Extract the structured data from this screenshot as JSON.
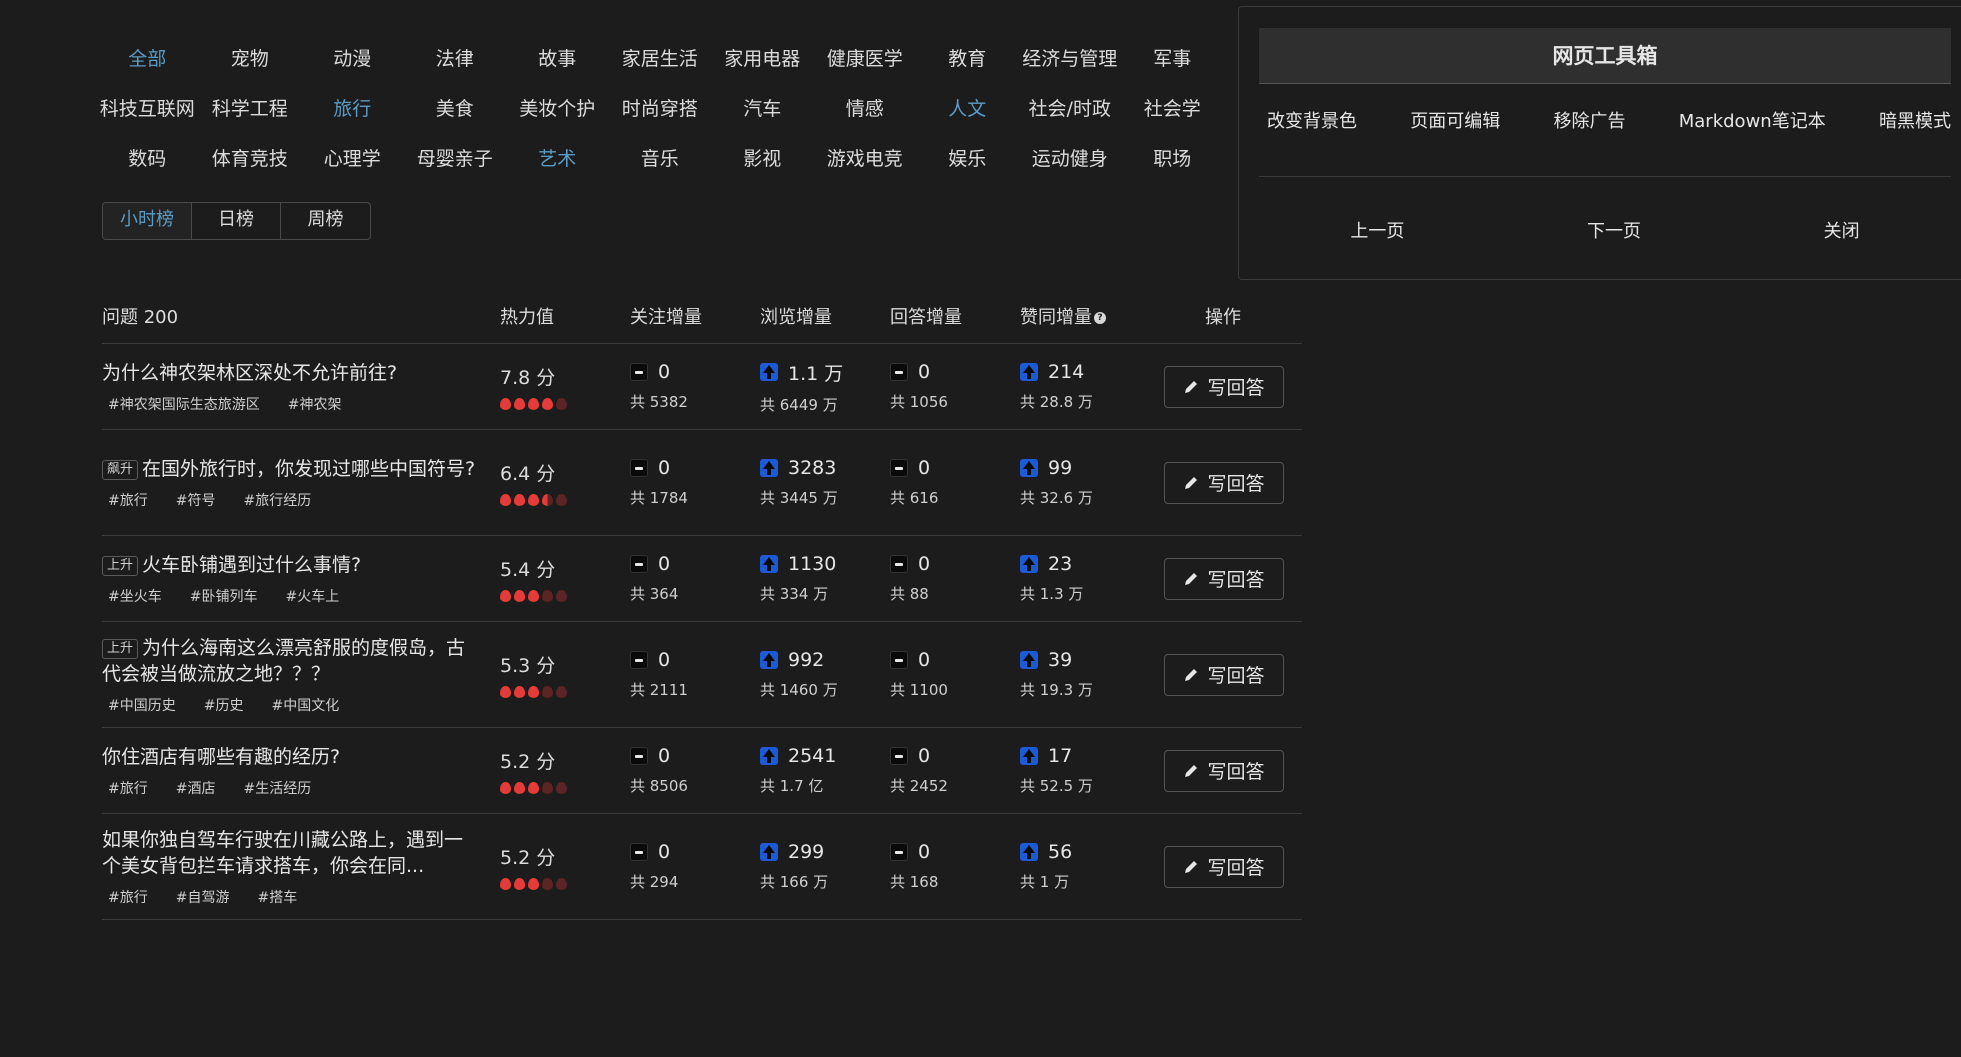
{
  "categories": [
    [
      {
        "label": "全部",
        "accent": true
      },
      {
        "label": "宠物"
      },
      {
        "label": "动漫"
      },
      {
        "label": "法律"
      },
      {
        "label": "故事"
      },
      {
        "label": "家居生活"
      },
      {
        "label": "家用电器"
      },
      {
        "label": "健康医学"
      },
      {
        "label": "教育"
      },
      {
        "label": "经济与管理"
      },
      {
        "label": "军事"
      }
    ],
    [
      {
        "label": "科技互联网"
      },
      {
        "label": "科学工程"
      },
      {
        "label": "旅行",
        "accent": true
      },
      {
        "label": "美食"
      },
      {
        "label": "美妆个护"
      },
      {
        "label": "时尚穿搭"
      },
      {
        "label": "汽车"
      },
      {
        "label": "情感"
      },
      {
        "label": "人文",
        "accent": true
      },
      {
        "label": "社会/时政"
      },
      {
        "label": "社会学"
      }
    ],
    [
      {
        "label": "数码"
      },
      {
        "label": "体育竞技"
      },
      {
        "label": "心理学"
      },
      {
        "label": "母婴亲子"
      },
      {
        "label": "艺术",
        "accent": true
      },
      {
        "label": "音乐"
      },
      {
        "label": "影视"
      },
      {
        "label": "游戏电竞"
      },
      {
        "label": "娱乐"
      },
      {
        "label": "运动健身"
      },
      {
        "label": "职场"
      }
    ]
  ],
  "tabs": [
    {
      "label": "小时榜",
      "active": true
    },
    {
      "label": "日榜"
    },
    {
      "label": "周榜"
    }
  ],
  "table": {
    "headers": {
      "question": "问题 200",
      "heat": "热力值",
      "follow": "关注增量",
      "view": "浏览增量",
      "answer": "回答增量",
      "upvote": "赞同增量",
      "op": "操作"
    },
    "answer_button": "写回答",
    "rows": [
      {
        "badge": "",
        "title": "为什么神农架林区深处不允许前往?",
        "tags": [
          "#神农架国际生态旅游区",
          "#神农架"
        ],
        "heat": "7.8 分",
        "flames": 4,
        "follow": {
          "trend": "flat",
          "delta": "0",
          "total": "共 5382"
        },
        "view": {
          "trend": "up",
          "delta": "1.1 万",
          "total": "共 6449 万"
        },
        "answer": {
          "trend": "flat",
          "delta": "0",
          "total": "共 1056"
        },
        "upvote": {
          "trend": "up",
          "delta": "214",
          "total": "共 28.8 万"
        }
      },
      {
        "badge": "飙升",
        "title": "在国外旅行时，你发现过哪些中国符号?",
        "tags": [
          "#旅行",
          "#符号",
          "#旅行经历"
        ],
        "heat": "6.4 分",
        "flames": 3.5,
        "follow": {
          "trend": "flat",
          "delta": "0",
          "total": "共 1784"
        },
        "view": {
          "trend": "up",
          "delta": "3283",
          "total": "共 3445 万"
        },
        "answer": {
          "trend": "flat",
          "delta": "0",
          "total": "共 616"
        },
        "upvote": {
          "trend": "up",
          "delta": "99",
          "total": "共 32.6 万"
        }
      },
      {
        "badge": "上升",
        "title": "火车卧铺遇到过什么事情?",
        "tags": [
          "#坐火车",
          "#卧铺列车",
          "#火车上"
        ],
        "heat": "5.4 分",
        "flames": 3,
        "follow": {
          "trend": "flat",
          "delta": "0",
          "total": "共 364"
        },
        "view": {
          "trend": "up",
          "delta": "1130",
          "total": "共 334 万"
        },
        "answer": {
          "trend": "flat",
          "delta": "0",
          "total": "共 88"
        },
        "upvote": {
          "trend": "up",
          "delta": "23",
          "total": "共 1.3 万"
        }
      },
      {
        "badge": "上升",
        "title": "为什么海南这么漂亮舒服的度假岛，古代会被当做流放之地？？？",
        "tags": [
          "#中国历史",
          "#历史",
          "#中国文化"
        ],
        "heat": "5.3 分",
        "flames": 3,
        "follow": {
          "trend": "flat",
          "delta": "0",
          "total": "共 2111"
        },
        "view": {
          "trend": "up",
          "delta": "992",
          "total": "共 1460 万"
        },
        "answer": {
          "trend": "flat",
          "delta": "0",
          "total": "共 1100"
        },
        "upvote": {
          "trend": "up",
          "delta": "39",
          "total": "共 19.3 万"
        }
      },
      {
        "badge": "",
        "title": "你住酒店有哪些有趣的经历?",
        "tags": [
          "#旅行",
          "#酒店",
          "#生活经历"
        ],
        "heat": "5.2 分",
        "flames": 3,
        "follow": {
          "trend": "flat",
          "delta": "0",
          "total": "共 8506"
        },
        "view": {
          "trend": "up",
          "delta": "2541",
          "total": "共 1.7 亿"
        },
        "answer": {
          "trend": "flat",
          "delta": "0",
          "total": "共 2452"
        },
        "upvote": {
          "trend": "up",
          "delta": "17",
          "total": "共 52.5 万"
        }
      },
      {
        "badge": "",
        "title": "如果你独自驾车行驶在川藏公路上，遇到一个美女背包拦车请求搭车，你会在同...",
        "tags": [
          "#旅行",
          "#自驾游",
          "#搭车"
        ],
        "heat": "5.2 分",
        "flames": 3,
        "follow": {
          "trend": "flat",
          "delta": "0",
          "total": "共 294"
        },
        "view": {
          "trend": "up",
          "delta": "299",
          "total": "共 166 万"
        },
        "answer": {
          "trend": "flat",
          "delta": "0",
          "total": "共 168"
        },
        "upvote": {
          "trend": "up",
          "delta": "56",
          "total": "共 1 万"
        }
      }
    ]
  },
  "toolbox": {
    "title": "网页工具箱",
    "actions": [
      "改变背景色",
      "页面可编辑",
      "移除广告",
      "Markdown笔记本",
      "暗黑模式"
    ],
    "nav": [
      "上一页",
      "下一页",
      "关闭"
    ]
  },
  "colors": {
    "background": "#1c1c1c",
    "accent": "#5b9bc7",
    "flame": "#e53b3b",
    "up_icon": "#1b5bd6"
  },
  "icons": {
    "trend_up": "arrow-up-icon",
    "trend_flat": "minus-icon",
    "heat": "flame-icon",
    "write": "pencil-icon"
  }
}
